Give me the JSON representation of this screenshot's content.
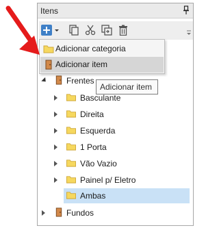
{
  "panel": {
    "title": "Itens"
  },
  "toolbar": {
    "buttons": [
      {
        "icon": "add-dropdown-icon"
      },
      {
        "icon": "copy-icon"
      },
      {
        "icon": "cut-icon"
      },
      {
        "icon": "paste-icon"
      },
      {
        "icon": "delete-icon"
      }
    ]
  },
  "menu": {
    "items": [
      {
        "label": "Adicionar categoria",
        "icon": "folder-icon"
      },
      {
        "label": "Adicionar item",
        "icon": "item-icon"
      }
    ]
  },
  "tooltip": {
    "text": "Adicionar item"
  },
  "tree": {
    "root": {
      "label": "Frentes"
    },
    "children": [
      {
        "label": "Basculante"
      },
      {
        "label": "Direita"
      },
      {
        "label": "Esquerda"
      },
      {
        "label": "1 Porta"
      },
      {
        "label": "Vão Vazio"
      },
      {
        "label": "Painel p/ Eletro"
      },
      {
        "label": "Ambas"
      }
    ],
    "sibling": {
      "label": "Fundos"
    }
  },
  "colors": {
    "folder": "#f6d85f",
    "item": "#d2894a",
    "selection": "#c9e1f6",
    "arrow": "#e51b1b",
    "toolbar_blue": "#3f80c7"
  }
}
